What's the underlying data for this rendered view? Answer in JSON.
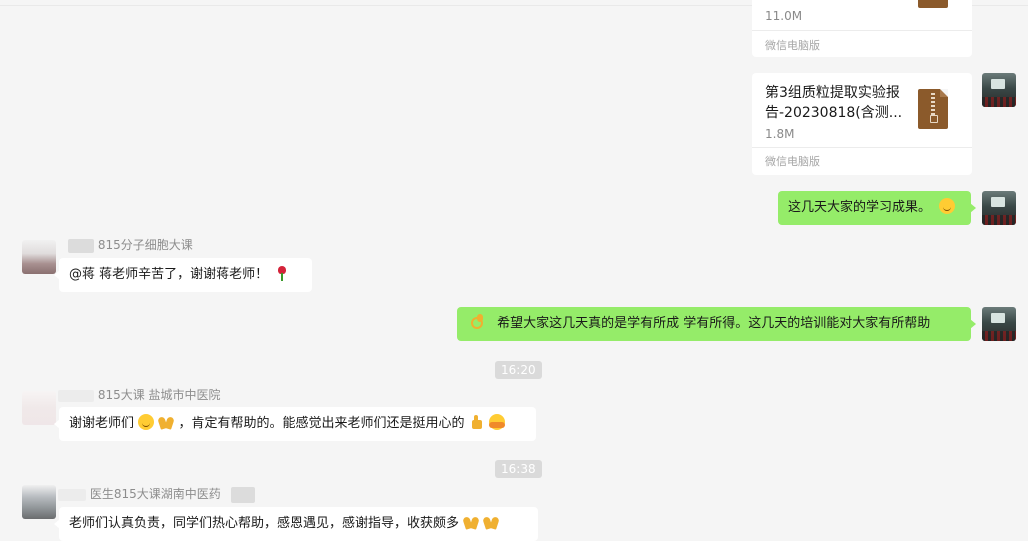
{
  "file_cards": [
    {
      "name": "",
      "size": "11.0M",
      "source": "微信电脑版"
    },
    {
      "name": "第3组质粒提取实验报告-20230818(含测...",
      "size": "1.8M",
      "source": "微信电脑版"
    }
  ],
  "messages": {
    "self_1": "这几天大家的学习成果。",
    "group_1_sender": "815分子细胞大课",
    "group_1_text": "@蒋 蒋老师辛苦了，谢谢蒋老师！",
    "self_2": "希望大家这几天真的是学有所成 学有所得。这几天的培训能对大家有所帮助",
    "group_2_sender": "815大课 盐城市中医院",
    "group_2_text_a": "谢谢老师们",
    "group_2_text_b": "，肯定有帮助的。能感觉出来老师们还是挺用心的",
    "group_3_sender": "医生815大课湖南中医药",
    "group_3_text": "老师们认真负责，同学们热心帮助，感恩遇见，感谢指导，收获颇多"
  },
  "timestamps": [
    "16:20",
    "16:38"
  ],
  "icons": {
    "file_type": "zip-file-icon",
    "emoji_smile": "smile-emoji",
    "emoji_rose": "rose-emoji",
    "emoji_ok": "ok-hand-emoji",
    "emoji_pray": "folded-hands-emoji",
    "emoji_thumb": "thumbs-up-emoji",
    "emoji_hug": "hugging-emoji"
  },
  "colors": {
    "self_bubble": "#95ec69",
    "other_bubble": "#ffffff",
    "background": "#f5f5f5",
    "file_icon": "#8b5a2b"
  }
}
